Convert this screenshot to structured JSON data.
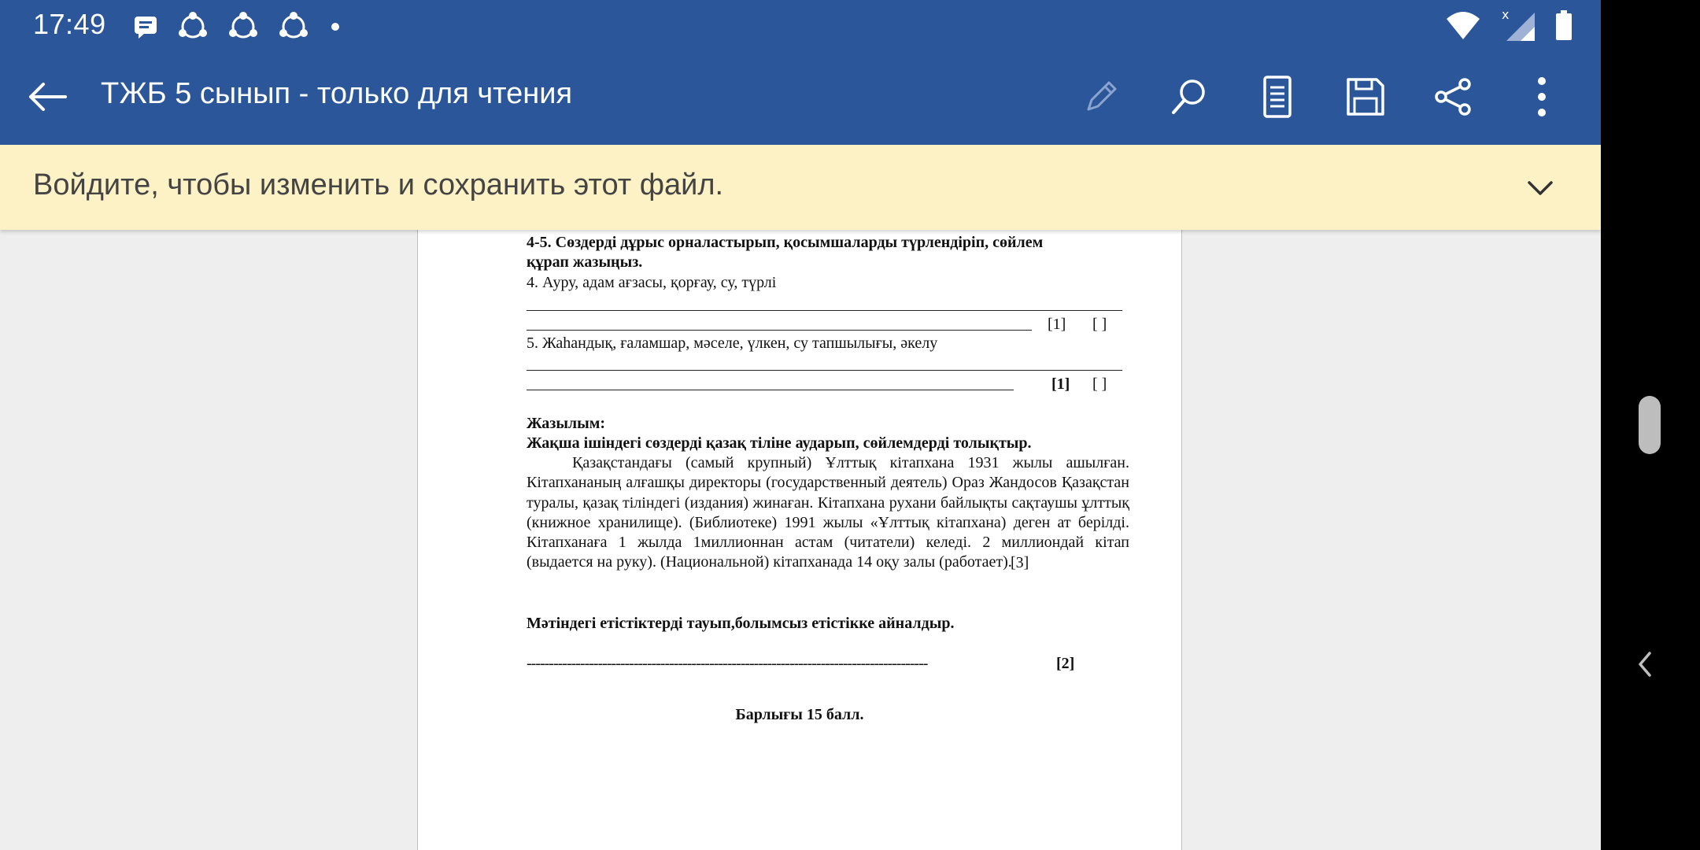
{
  "status": {
    "time": "17:49",
    "notification_icons": [
      "message-icon",
      "share-nodes-icon",
      "share-nodes-icon",
      "share-nodes-icon",
      "dot-icon"
    ],
    "right_icons": [
      "wifi-icon",
      "signal-icon",
      "battery-icon"
    ]
  },
  "app_bar": {
    "title": "ТЖБ 5 сынып - только для чтения",
    "actions": [
      "edit-icon",
      "search-icon",
      "read-mode-icon",
      "save-icon",
      "share-icon",
      "more-icon"
    ]
  },
  "banner": {
    "text": "Войдите, чтобы изменить и сохранить этот файл."
  },
  "document": {
    "task45_heading_1": "4-5. Сөздерді дұрыс орналастырып, қосымшаларды түрлендіріп, сөйлем",
    "task45_heading_2": "құрап жазыңыз.",
    "task4_words": "4. Ауру, адам ағзасы, қорғау, су, түрлі",
    "task4_score": "[1]",
    "task4_blank": "[   ]",
    "task5_words": "5. Жаһандық, ғаламшар, мәселе, үлкен, су тапшылығы, әкелу",
    "task5_score": "[1]",
    "task5_blank": "[   ]",
    "writing_heading": "Жазылым:",
    "writing_instruction": "Жақша ішіндегі сөздерді қазақ тіліне аударып, сөйлемдерді толықтыр.",
    "paragraph": "Қазақстандағы (самый крупный) Ұлттық кітапхана 1931 жылы ашылған. Кітапхананың алғашқы директоры (государственный деятель) Ораз Жандосов Қазақстан туралы, қазақ тіліндегі (издания) жинаған. Кітапхана рухани байлықты сақтаушы ұлттық (книжное хранилище). (Библиотеке) 1991 жылы «Ұлттық кітапхана) деген ат берілді. Кітапханаға 1 жылда   1миллионнан астам (читатели) келеді. 2 миллиондай кітап (выдается на руку). (Национальной) кітапханада 14 оқу залы (работает).",
    "paragraph_score": "[3]",
    "verbs_task": "Мәтіндегі  етістіктерді  тауып,болымсыз етістікке  айналдыр.",
    "verbs_dashes": "------------------------------------------------------------------------------------------",
    "verbs_score": "[2]",
    "total": "Барлығы 15 балл."
  }
}
